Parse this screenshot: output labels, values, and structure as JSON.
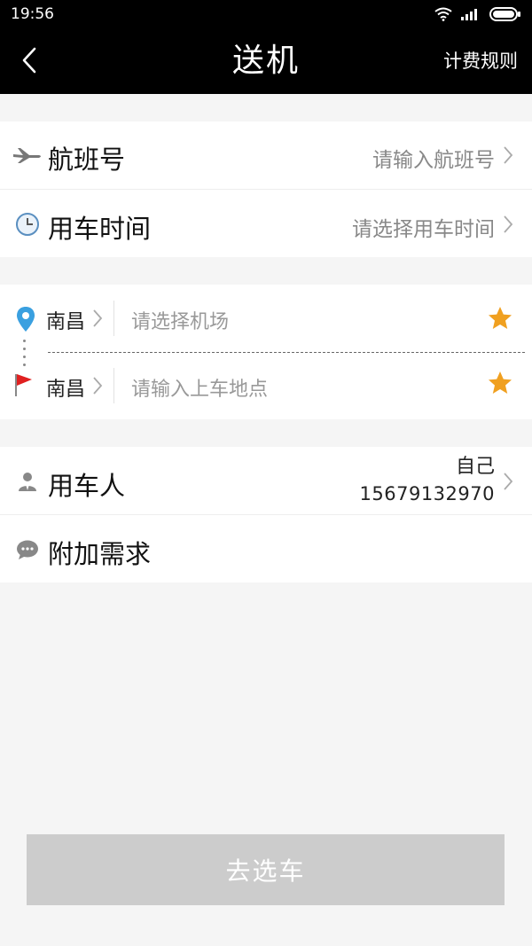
{
  "status_bar": {
    "time": "19:56"
  },
  "header": {
    "title": "送机",
    "right_action": "计费规则"
  },
  "flight_section": {
    "flight_number": {
      "label": "航班号",
      "placeholder": "请输入航班号",
      "icon": "airplane-icon"
    },
    "use_time": {
      "label": "用车时间",
      "placeholder": "请选择用车时间",
      "icon": "clock-icon"
    }
  },
  "route_section": {
    "start": {
      "city": "南昌",
      "placeholder": "请选择机场",
      "icon": "location-pin-icon"
    },
    "end": {
      "city": "南昌",
      "placeholder": "请输入上车地点",
      "icon": "flag-icon"
    }
  },
  "passenger_section": {
    "passenger": {
      "label": "用车人",
      "name": "自己",
      "phone": "15679132970",
      "icon": "person-icon"
    },
    "extra": {
      "label": "附加需求",
      "icon": "chat-bubble-icon"
    }
  },
  "footer": {
    "button_label": "去选车"
  },
  "colors": {
    "header_bg": "#000000",
    "page_bg": "#f5f5f5",
    "star": "#f0a020",
    "pin": "#3aa0e0",
    "flag": "#e02020",
    "button_disabled": "#cccccc"
  }
}
